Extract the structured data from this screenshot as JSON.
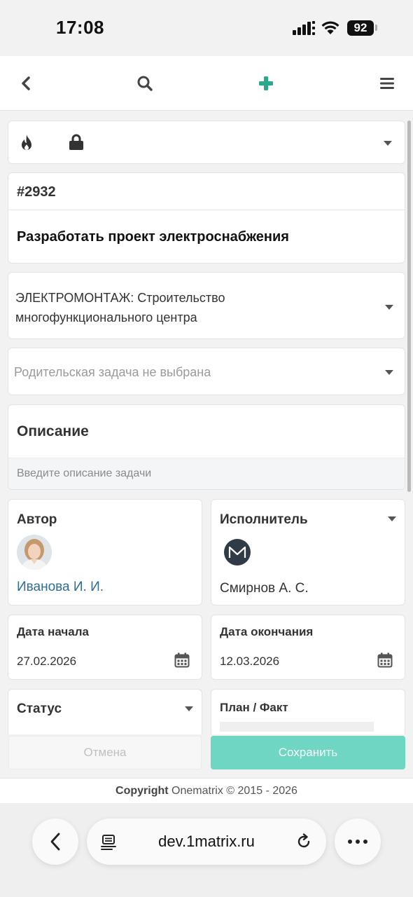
{
  "status_bar": {
    "time": "17:08",
    "battery": "92"
  },
  "nav": {
    "back": "back-icon",
    "search": "search-icon",
    "add": "plus-icon",
    "menu": "hamburger-icon",
    "accent": "#2aa88a"
  },
  "task": {
    "id": "#2932",
    "title": "Разработать проект электроснабжения",
    "project": "ЭЛЕКТРОМОНТАЖ: Строительство многофункционального центра",
    "parent_placeholder": "Родительская задача не выбрана"
  },
  "description": {
    "label": "Описание",
    "placeholder": "Введите описание задачи"
  },
  "author": {
    "label": "Автор",
    "name": "Иванова И. И."
  },
  "assignee": {
    "label": "Исполнитель",
    "name": "Смирнов А. С."
  },
  "dates": {
    "start_label": "Дата начала",
    "start_value": "27.02.2026",
    "end_label": "Дата окончания",
    "end_value": "12.03.2026"
  },
  "status": {
    "label": "Статус"
  },
  "plan_fact": {
    "label": "План / Факт"
  },
  "actions": {
    "cancel": "Отмена",
    "save": "Сохранить",
    "save_color": "#6ed6c2"
  },
  "footer": {
    "copyright_bold": "Copyright",
    "copyright_rest": "Onematrix © 2015 - 2026"
  },
  "browser": {
    "url": "dev.1matrix.ru"
  }
}
